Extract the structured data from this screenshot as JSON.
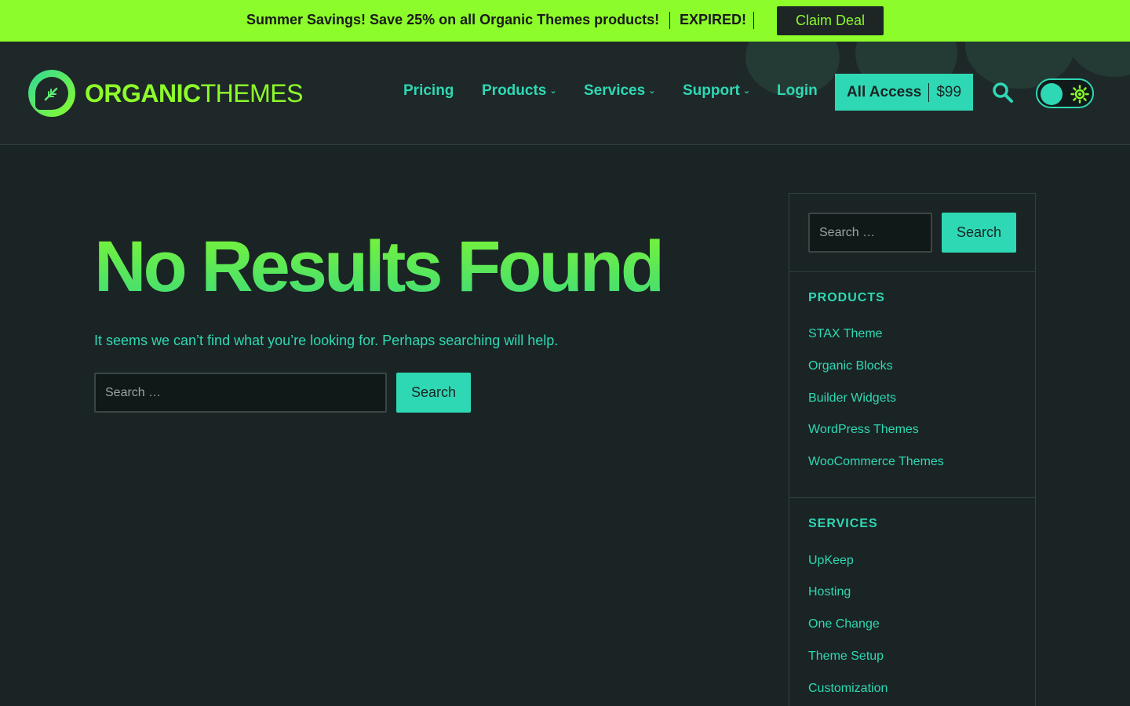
{
  "promo": {
    "text": "Summer Savings! Save 25% on all Organic Themes products!",
    "status": "EXPIRED!",
    "button": "Claim Deal"
  },
  "logo": {
    "bold": "ORGANIC",
    "light": "THEMES"
  },
  "nav": [
    {
      "label": "Pricing",
      "dropdown": false
    },
    {
      "label": "Products",
      "dropdown": true
    },
    {
      "label": "Services",
      "dropdown": true
    },
    {
      "label": "Support",
      "dropdown": true
    },
    {
      "label": "Login",
      "dropdown": false
    }
  ],
  "cta": {
    "label": "All Access",
    "price": "$99"
  },
  "main": {
    "title": "No Results Found",
    "description": "It seems we can’t find what you’re looking for. Perhaps searching will help.",
    "search_placeholder": "Search …",
    "search_button": "Search"
  },
  "sidebar": {
    "search_placeholder": "Search …",
    "search_button": "Search",
    "products_heading": "PRODUCTS",
    "products": [
      "STAX Theme",
      "Organic Blocks",
      "Builder Widgets",
      "WordPress Themes",
      "WooCommerce Themes"
    ],
    "services_heading": "SERVICES",
    "services": [
      "UpKeep",
      "Hosting",
      "One Change",
      "Theme Setup",
      "Customization"
    ]
  },
  "colors": {
    "background": "#1a2424",
    "promo_bar": "#8cfc2a",
    "accent": "#2fd8b4",
    "title_gradient_top": "#7cf534",
    "title_gradient_bottom": "#3ddb7a"
  }
}
